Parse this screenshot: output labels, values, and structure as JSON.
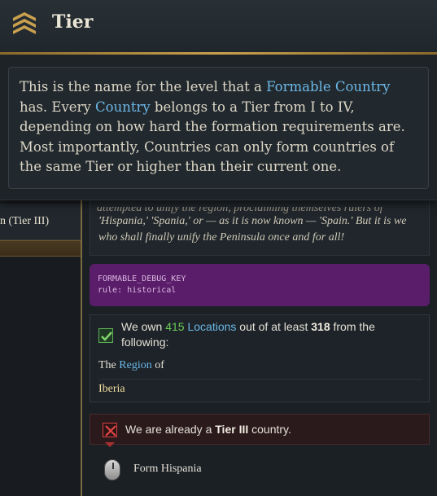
{
  "tooltip": {
    "title": "Tier",
    "icon": "tier-chevrons-icon",
    "body_part1": "This is the name for the level that a ",
    "link_formable": "Formable Country",
    "body_part2": " has. Every ",
    "link_country": "Country",
    "body_part3": " belongs to a Tier from I to IV, depending on how hard the formation requirements are. Most importantly, Countries can only form countries of the same Tier or higher than their current one."
  },
  "left_panel": {
    "tier_label": "n (Tier III)"
  },
  "lore": {
    "cut_line": "attempted to unify the region, proclaiming themselves rulers of",
    "text": "'Hispania,' 'Spania,' or — as it is now known — 'Spain.' But it is we who shall finally unify the Peninsula once and for all!"
  },
  "debug": {
    "key": "FORMABLE_DEBUG_KEY",
    "rule": "rule: historical"
  },
  "requirement": {
    "prefix": "We own ",
    "owned": "415",
    "link": "Locations",
    "middle": " out of at least ",
    "needed": "318",
    "suffix": " from the following:",
    "sub_prefix": "The ",
    "sub_link": "Region",
    "sub_suffix": " of",
    "region": "Iberia"
  },
  "failure": {
    "prefix": "We are already a ",
    "tier": "Tier III",
    "suffix": " country."
  },
  "action": {
    "label": "Form Hispania"
  },
  "colors": {
    "accent_gold": "#c9a04e",
    "link_blue": "#6cb8e8",
    "ok_green": "#6ccf5a",
    "fail_red": "#d64040",
    "debug_purple": "#5a1d6a"
  }
}
